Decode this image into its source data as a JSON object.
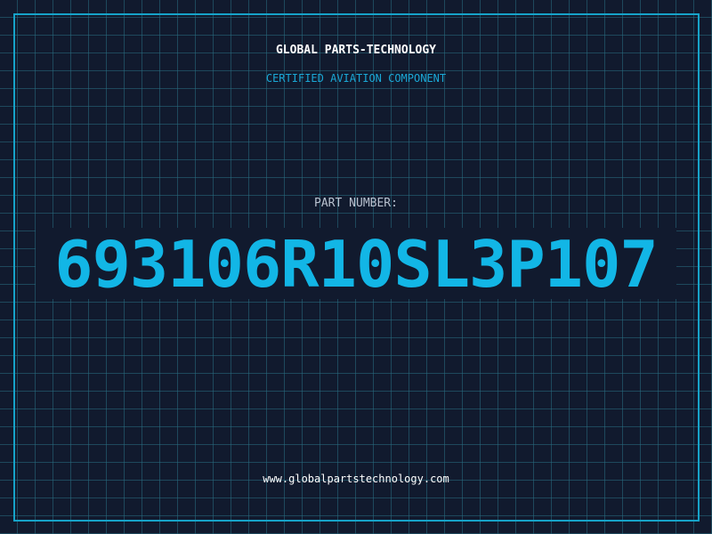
{
  "header": {
    "brand": "GLOBAL PARTS-TECHNOLOGY",
    "subtitle": "CERTIFIED AVIATION COMPONENT"
  },
  "part": {
    "label": "PART NUMBER:",
    "number": "693106R10SL3P107"
  },
  "footer": {
    "url": "www.globalpartstechnology.com"
  },
  "colors": {
    "background": "#111a2e",
    "grid": "#286e82",
    "accent": "#12b6e6",
    "frame": "#16a3c9"
  }
}
